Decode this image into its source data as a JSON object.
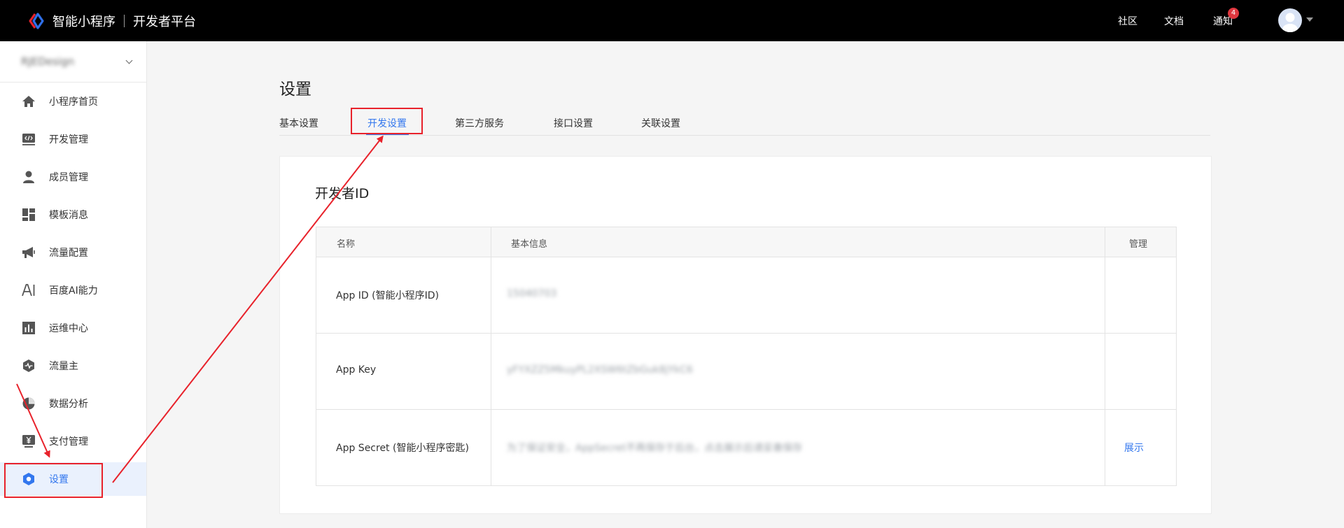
{
  "header": {
    "brand": "智能小程序",
    "subtitle": "开发者平台",
    "nav": [
      "社区",
      "文档",
      "通知"
    ],
    "notification_count": "4"
  },
  "sidebar": {
    "project_name": "RJEDesign",
    "items": [
      {
        "label": "小程序首页",
        "icon": "home-icon"
      },
      {
        "label": "开发管理",
        "icon": "code-icon"
      },
      {
        "label": "成员管理",
        "icon": "user-icon"
      },
      {
        "label": "模板消息",
        "icon": "template-icon"
      },
      {
        "label": "流量配置",
        "icon": "megaphone-icon"
      },
      {
        "label": "百度AI能力",
        "icon": "ai-icon"
      },
      {
        "label": "运维中心",
        "icon": "bar-chart-icon"
      },
      {
        "label": "流量主",
        "icon": "hexagon-pulse-icon"
      },
      {
        "label": "数据分析",
        "icon": "pie-chart-icon"
      },
      {
        "label": "支付管理",
        "icon": "yuan-icon"
      },
      {
        "label": "设置",
        "icon": "settings-icon"
      }
    ],
    "active_index": 10
  },
  "main": {
    "title": "设置",
    "tabs": [
      {
        "label": "基本设置"
      },
      {
        "label": "开发设置"
      },
      {
        "label": "第三方服务"
      },
      {
        "label": "接口设置"
      },
      {
        "label": "关联设置"
      }
    ],
    "active_tab": 1,
    "section_title": "开发者ID",
    "table": {
      "headers": [
        "名称",
        "基本信息",
        "管理"
      ],
      "rows": [
        {
          "name": "App ID (智能小程序ID)",
          "info": "15040703",
          "action": ""
        },
        {
          "name": "App Key",
          "info": "yFYXZZ5MkuyPL2XSW6tZbGuk8jYkC6",
          "action": ""
        },
        {
          "name": "App Secret (智能小程序密匙)",
          "info": "为了保证安全，AppSecret不再保存于后台，点击展示后请妥善保存",
          "action": "展示"
        }
      ]
    }
  },
  "colors": {
    "accent": "#3377ee",
    "annotation_red": "#e8222b",
    "topbar": "#000000"
  }
}
